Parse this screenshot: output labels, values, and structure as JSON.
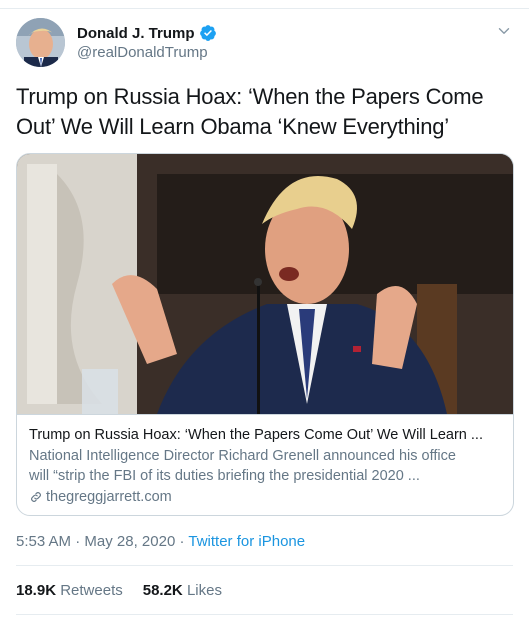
{
  "author": {
    "display_name": "Donald J. Trump",
    "handle": "@realDonaldTrump"
  },
  "icons": {
    "verified": "verified-badge-icon",
    "more": "chevron-down-icon",
    "link": "link-icon"
  },
  "tweet": {
    "text": "Trump on Russia Hoax: ‘When the Papers Come Out’ We Will Learn Obama ‘Knew Everything’"
  },
  "card": {
    "title": "Trump on Russia Hoax: ‘When the Papers Come Out’ We Will Learn ...",
    "description_line1": "National Intelligence Director Richard Grenell announced his office",
    "description_line2": "will “strip the FBI of its duties briefing the presidential 2020 ...",
    "domain": "thegreggjarrett.com"
  },
  "meta": {
    "time": "5:53 AM",
    "date": "May 28, 2020",
    "separator": "·",
    "source": "Twitter for iPhone"
  },
  "stats": {
    "retweets_count": "18.9K",
    "retweets_label": "Retweets",
    "likes_count": "58.2K",
    "likes_label": "Likes"
  },
  "colors": {
    "accent": "#1b95e0",
    "verified": "#1da1f2",
    "secondary_text": "#657786",
    "border": "#ccd6dd"
  }
}
